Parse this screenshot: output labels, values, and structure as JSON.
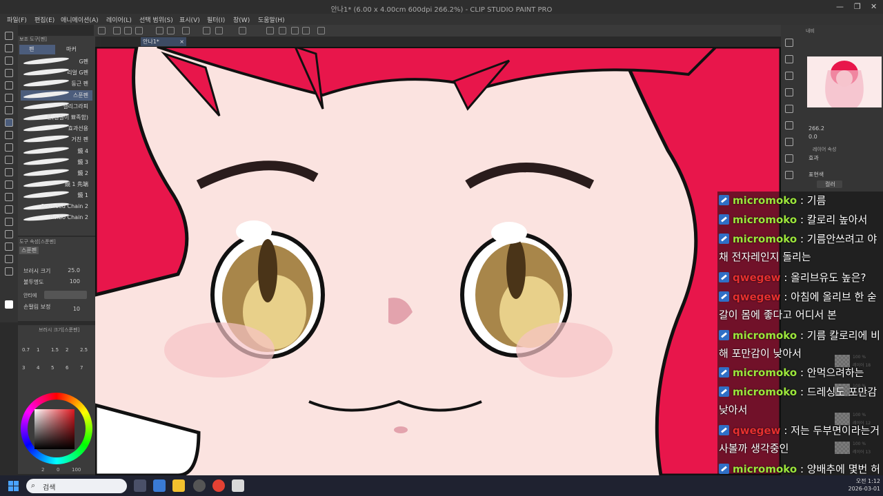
{
  "window": {
    "title": "안나1* (6.00 x 4.00cm 600dpi 266.2%) - CLIP STUDIO PAINT PRO"
  },
  "menu": [
    "파일(F)",
    "편집(E)",
    "애니메이션(A)",
    "레이어(L)",
    "선택 범위(S)",
    "표시(V)",
    "필터(I)",
    "창(W)",
    "도움말(H)"
  ],
  "document_tab": {
    "label": "안나1*"
  },
  "subtool": {
    "header": "보조 도구[펜]",
    "tabs": [
      "펜",
      "마커"
    ],
    "brushes": [
      "G펜",
      "리얼 G펜",
      "둥근 펜",
      "스푼펜",
      "캘리그라피",
      "팬(일필이 뾰족함)",
      "효과선용",
      "거친 펜",
      "鏡 4",
      "鏡 3",
      "鏡 2",
      "鏡 1 先端",
      "鏡 1",
      "Rounded Chain 2",
      "Ro.bo Chain 2"
    ]
  },
  "tool_property": {
    "header": "도구 속성[스푼펜]",
    "tool_name": "스푼펜",
    "brush_size_label": "브러시 크기",
    "brush_size_value": "25.0",
    "opacity_label": "불투명도",
    "opacity_value": "100",
    "aa_label": "안티에",
    "stabilization_label": "손떨림 보정",
    "stabilization_value": "10"
  },
  "brush_size_palette": {
    "header": "브러시 크기[스푼펜]",
    "sizes": [
      "0.7",
      "1",
      "1.5",
      "2",
      "2.5",
      "3",
      "4",
      "5",
      "6",
      "7"
    ]
  },
  "color_footer": {
    "h": "2",
    "s": "0",
    "v": "100"
  },
  "right_panel": {
    "navigator_label": "내비",
    "zoom_value": "266.2",
    "angle_value": "0.0",
    "layer_property_label": "레이어 속성",
    "effect_label": "효과",
    "expression_label": "표현색",
    "expression_value": "컬러"
  },
  "layers": [
    {
      "opacity": "100 %",
      "name": "레이어 18"
    },
    {
      "opacity": "100 %",
      "name": "레이어 16"
    },
    {
      "opacity": "100 %",
      "name": "레이어 12"
    },
    {
      "opacity": "100 %",
      "name": "레이어 13"
    }
  ],
  "chat": [
    {
      "user": "micromoko",
      "user_color": "#9ce63c",
      "text": "기름"
    },
    {
      "user": "micromoko",
      "user_color": "#9ce63c",
      "text": "칼로리 높아서"
    },
    {
      "user": "micromoko",
      "user_color": "#9ce63c",
      "text": "기름안쓰려고 야채 전자레인지 돌리는"
    },
    {
      "user": "qwegew",
      "user_color": "#e83030",
      "text": "올리브유도 높은?"
    },
    {
      "user": "qwegew",
      "user_color": "#e83030",
      "text": "아침에 올리브 한 숟갈이 몸에 좋다고 어디서 본"
    },
    {
      "user": "micromoko",
      "user_color": "#9ce63c",
      "text": "기름 칼로리에 비해 포만감이 낮아서"
    },
    {
      "user": "micromoko",
      "user_color": "#9ce63c",
      "text": "안먹으려하는"
    },
    {
      "user": "micromoko",
      "user_color": "#9ce63c",
      "text": "드레싱도 포만감 낮아서"
    },
    {
      "user": "qwegew",
      "user_color": "#e83030",
      "text": "저는 두부면이라는거 사볼까 생각중인"
    },
    {
      "user": "micromoko",
      "user_color": "#9ce63c",
      "text": "양배추에 몇번 허브솔트를 뿌려먹었는데"
    }
  ],
  "taskbar": {
    "search_placeholder": "검색",
    "time": "오전 1:12",
    "date": "2026-03-01"
  }
}
